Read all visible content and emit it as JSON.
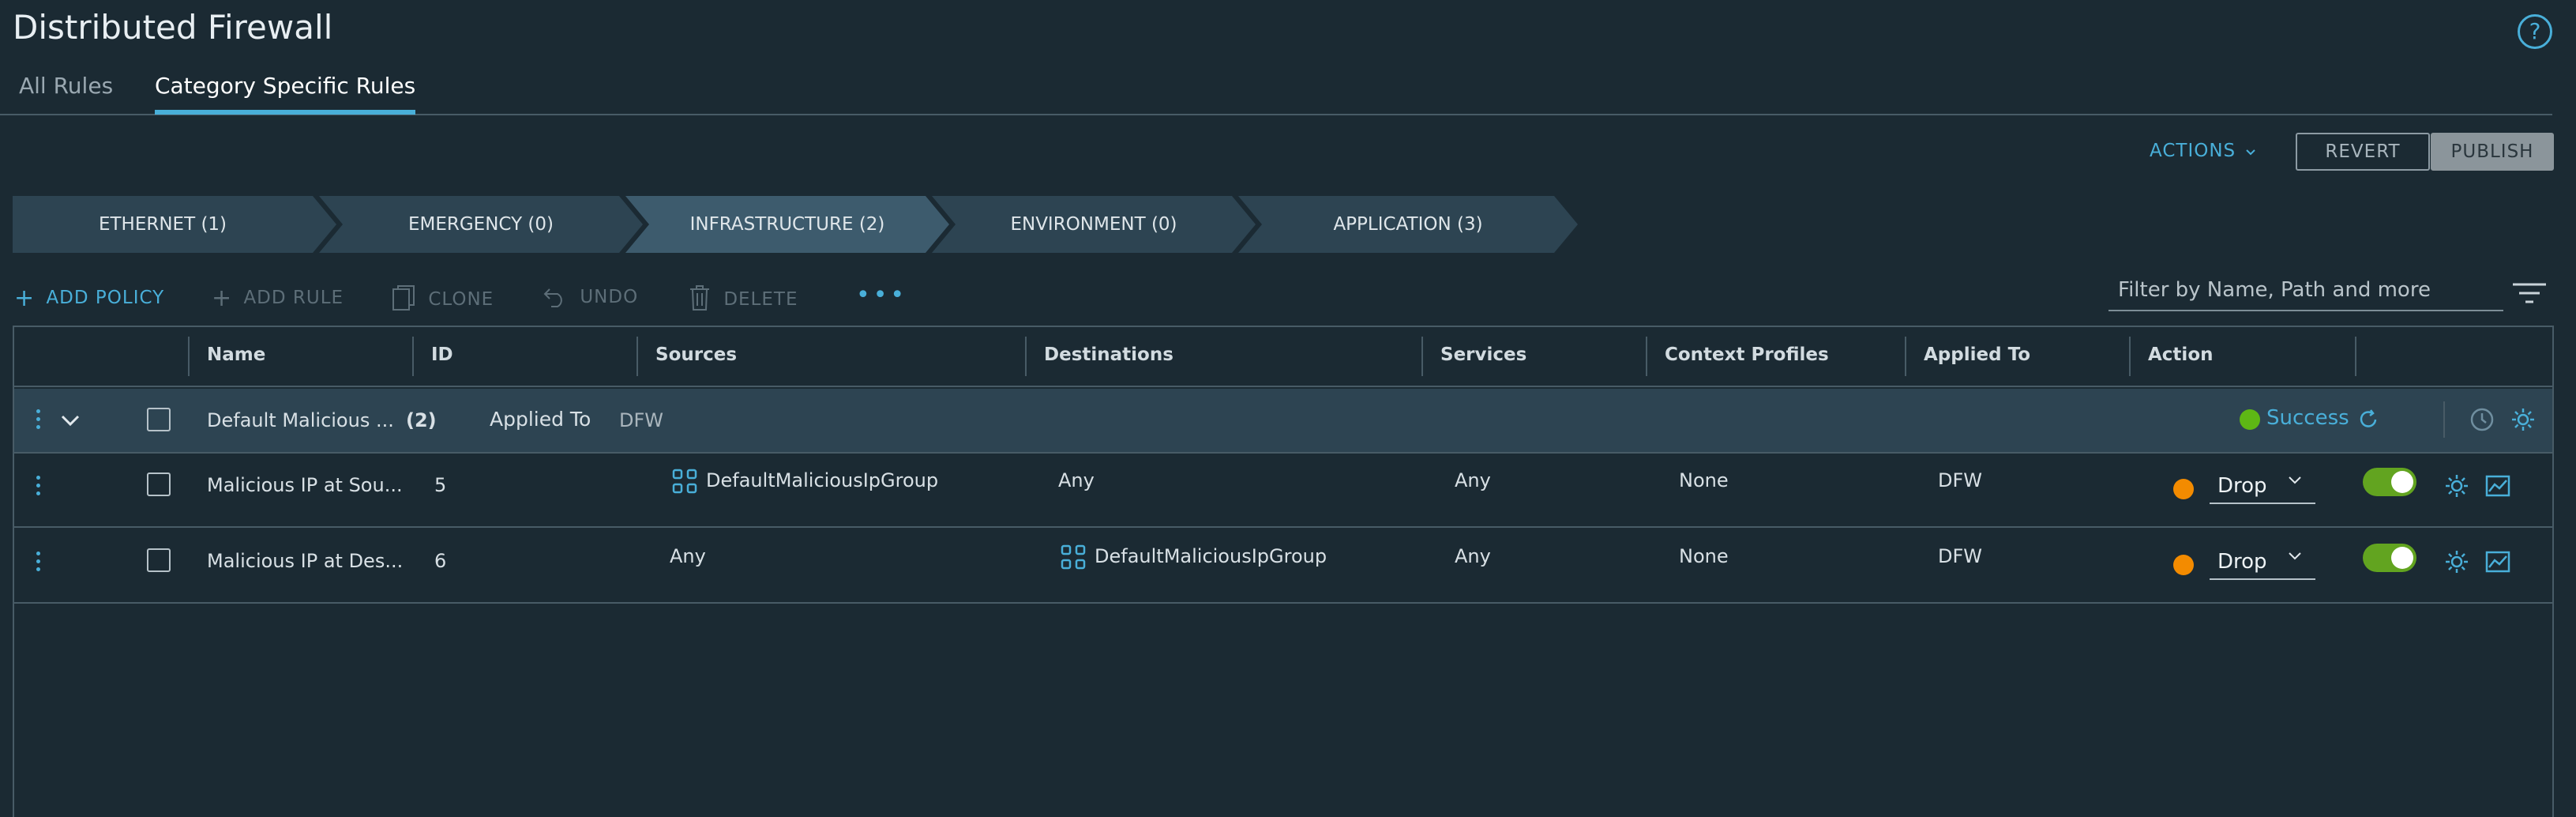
{
  "page": {
    "title": "Distributed Firewall"
  },
  "tabs": [
    {
      "label": "All Rules",
      "active": false
    },
    {
      "label": "Category Specific Rules",
      "active": true
    }
  ],
  "top_actions": {
    "actions_label": "ACTIONS",
    "revert_label": "REVERT",
    "publish_label": "PUBLISH"
  },
  "categories": [
    {
      "label": "ETHERNET (1)",
      "active": false
    },
    {
      "label": "EMERGENCY (0)",
      "active": false
    },
    {
      "label": "INFRASTRUCTURE (2)",
      "active": true
    },
    {
      "label": "ENVIRONMENT (0)",
      "active": false
    },
    {
      "label": "APPLICATION (3)",
      "active": false
    }
  ],
  "toolbar": {
    "add_policy": "ADD POLICY",
    "add_rule": "ADD RULE",
    "clone": "CLONE",
    "undo": "UNDO",
    "delete": "DELETE",
    "filter_placeholder": "Filter by Name, Path and more"
  },
  "columns": [
    "Name",
    "ID",
    "Sources",
    "Destinations",
    "Services",
    "Context Profiles",
    "Applied To",
    "Action"
  ],
  "policy": {
    "name": "Default Malicious ...",
    "count": "(2)",
    "applied_to_label": "Applied To",
    "applied_to_value": "DFW",
    "status": "Success"
  },
  "rules": [
    {
      "name": "Malicious IP at Sou...",
      "id": "5",
      "sources": "DefaultMaliciousIpGroup",
      "destinations": "Any",
      "services": "Any",
      "context_profiles": "None",
      "applied_to": "DFW",
      "action": "Drop",
      "enabled": true
    },
    {
      "name": "Malicious IP at Des...",
      "id": "6",
      "sources": "Any",
      "destinations": "DefaultMaliciousIpGroup",
      "services": "Any",
      "context_profiles": "None",
      "applied_to": "DFW",
      "action": "Drop",
      "enabled": true
    }
  ],
  "colors": {
    "accent": "#49afd9",
    "success": "#5eb715",
    "drop_action": "#f38b00",
    "toggle_on": "#62a420",
    "background": "#1b2a33"
  }
}
